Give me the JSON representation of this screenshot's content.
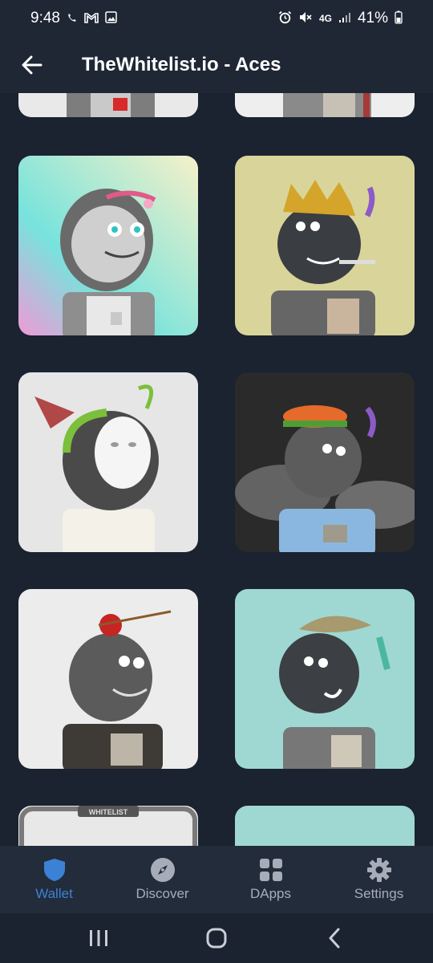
{
  "status_bar": {
    "time": "9:48",
    "battery_percent": "41%",
    "network": "4G",
    "left_icons": [
      "wifi-calling-icon",
      "gmail-icon",
      "gallery-icon"
    ],
    "right_icons": [
      "alarm-icon",
      "mute-icon",
      "signal-icon",
      "battery-icon"
    ]
  },
  "app_bar": {
    "title": "TheWhitelist.io - Aces",
    "back_icon": "arrow-left-icon"
  },
  "nfts": [
    {
      "variant": "partial-top-left"
    },
    {
      "variant": "partial-top-right"
    },
    {
      "variant": "helmet-astronaut",
      "background": "pastel-gradient"
    },
    {
      "variant": "crown-rock",
      "background": "#d9d59a"
    },
    {
      "variant": "mask-anglerfish",
      "background": "#e6e6e6"
    },
    {
      "variant": "burger-rock",
      "background": "#2a2a2a"
    },
    {
      "variant": "apple-arrow-rock",
      "background": "#ececec"
    },
    {
      "variant": "shark-rock",
      "background": "#9fd8d2"
    },
    {
      "variant": "whitelist-frame",
      "background": "#e8e8e8",
      "badge_text": "WHITELIST"
    },
    {
      "variant": "partial-bottom-right",
      "background": "#9fd8d2"
    }
  ],
  "bottom_nav": {
    "items": [
      {
        "label": "Wallet",
        "icon": "shield-icon",
        "active": true
      },
      {
        "label": "Discover",
        "icon": "compass-icon",
        "active": false
      },
      {
        "label": "DApps",
        "icon": "grid-icon",
        "active": false
      },
      {
        "label": "Settings",
        "icon": "gear-icon",
        "active": false
      }
    ]
  },
  "colors": {
    "background": "#1b2230",
    "appbar": "#1f2735",
    "nav_bg": "#232c3b",
    "accent": "#3b82d6",
    "inactive": "#a6adb9"
  }
}
